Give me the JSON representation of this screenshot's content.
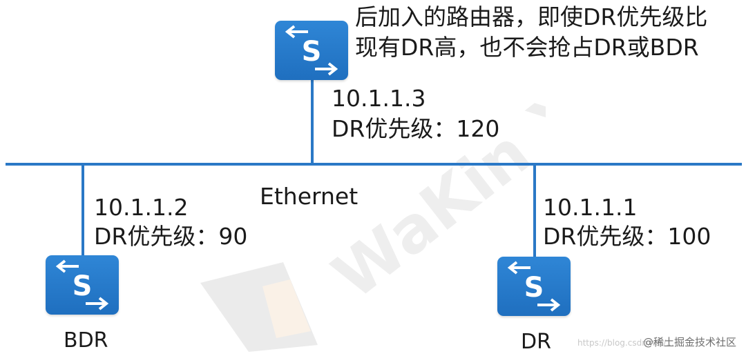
{
  "annotation": {
    "line1": "后加入的路由器，即使DR优先级比",
    "line2": "现有DR高，也不会抢占DR或BDR"
  },
  "network": {
    "label": "Ethernet"
  },
  "routers": [
    {
      "id": "new",
      "ip": "10.1.1.3",
      "priority_text": "DR优先级：120",
      "icon_letter": "S",
      "role": ""
    },
    {
      "id": "bdr",
      "ip": "10.1.1.2",
      "priority_text": "DR优先级：90",
      "icon_letter": "S",
      "role": "BDR"
    },
    {
      "id": "dr",
      "ip": "10.1.1.1",
      "priority_text": "DR优先级：100",
      "icon_letter": "S",
      "role": "DR"
    }
  ],
  "watermark": {
    "text": "WaKin Xie"
  },
  "credit": {
    "text": "@稀土掘金技术社区",
    "faint_text": "https://blog.csdn.net/..."
  },
  "colors": {
    "link": "#2a78c6",
    "router_fill": "#2377c9",
    "router_symbol": "#ffffff"
  }
}
